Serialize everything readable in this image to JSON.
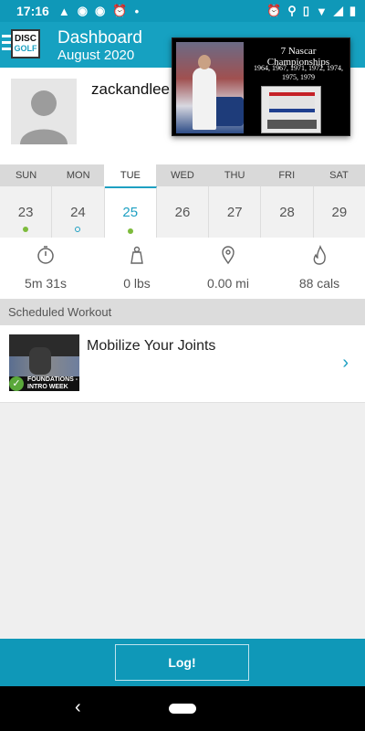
{
  "status_bar": {
    "time": "17:16",
    "icons_left": [
      "navigation-icon",
      "circle-icon",
      "circle-icon",
      "alarm-icon",
      "dot-icon"
    ],
    "icons_right": [
      "alarm-icon",
      "location-icon",
      "vibrate-icon",
      "wifi-icon",
      "signal-icon",
      "battery-icon"
    ]
  },
  "header": {
    "logo_top": "DISC",
    "logo_bottom": "GOLF",
    "title": "Dashboard",
    "subtitle": "August 2020"
  },
  "profile": {
    "username": "zackandlee"
  },
  "ad": {
    "title": "7 Nascar Championships",
    "years": "1964, 1967, 1971, 1972, 1974, 1975, 1979"
  },
  "calendar": {
    "weekdays": [
      "SUN",
      "MON",
      "TUE",
      "WED",
      "THU",
      "FRI",
      "SAT"
    ],
    "days": [
      {
        "num": "23",
        "dot": "filled"
      },
      {
        "num": "24",
        "dot": "ring"
      },
      {
        "num": "25",
        "dot": "filled",
        "active": true
      },
      {
        "num": "26",
        "dot": ""
      },
      {
        "num": "27",
        "dot": ""
      },
      {
        "num": "28",
        "dot": ""
      },
      {
        "num": "29",
        "dot": ""
      }
    ],
    "active_index": 2
  },
  "stats": [
    {
      "icon": "stopwatch-icon",
      "value": "5m 31s"
    },
    {
      "icon": "weight-icon",
      "value": "0 lbs"
    },
    {
      "icon": "location-pin-icon",
      "value": "0.00 mi"
    },
    {
      "icon": "flame-icon",
      "value": "88 cals"
    }
  ],
  "scheduled": {
    "header": "Scheduled Workout",
    "workout_title": "Mobilize Your Joints",
    "thumb_caption_1": "FOUNDATIONS -",
    "thumb_caption_2": "INTRO WEEK"
  },
  "log_button": "Log!",
  "colors": {
    "primary": "#16a1c1",
    "accent": "#1ea0c2",
    "dot_green": "#7dbb3c"
  }
}
